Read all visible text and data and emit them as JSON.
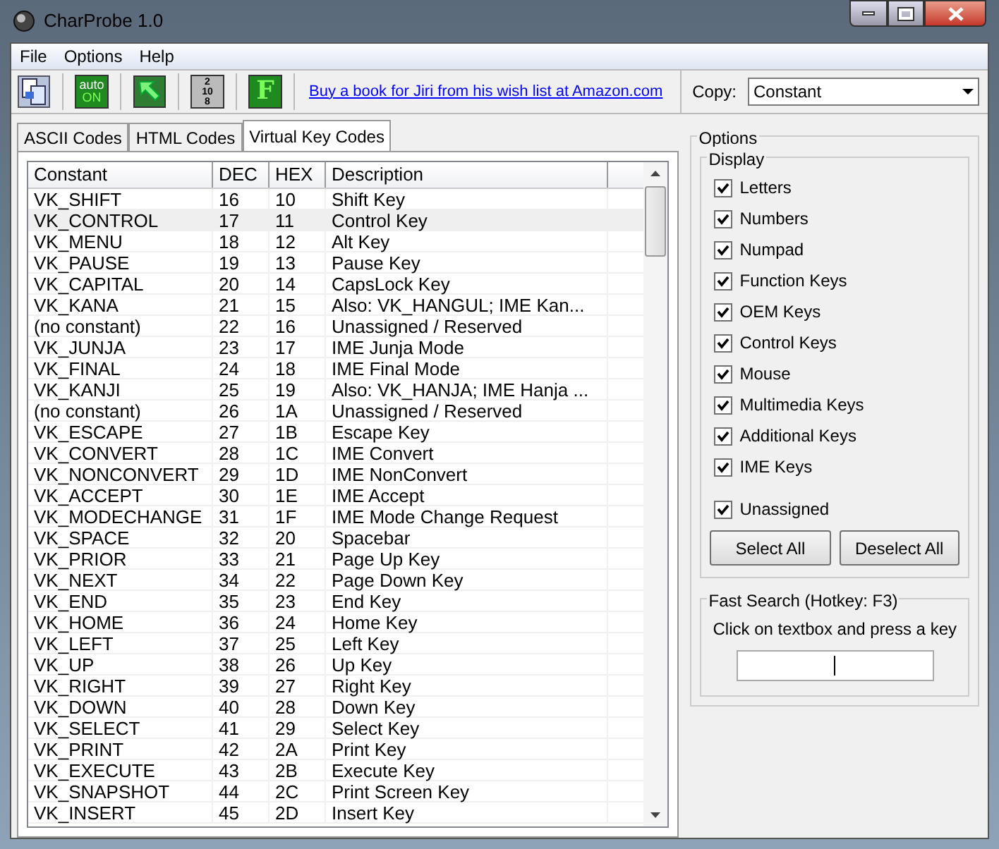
{
  "window": {
    "title": "CharProbe 1.0"
  },
  "menu": [
    "File",
    "Options",
    "Help"
  ],
  "toolbar": {
    "buttons": [
      {
        "kind": "icon"
      },
      {
        "kind": "badge",
        "text": [
          "auto",
          "ON"
        ]
      },
      {
        "kind": "icon"
      },
      {
        "kind": "badge",
        "text": [
          "2",
          "10",
          "8"
        ]
      },
      {
        "kind": "badge",
        "text": [
          "F"
        ]
      }
    ],
    "link": "Buy a book for Jiri from his wish list at Amazon.com",
    "copy_label": "Copy:",
    "copy_value": "Constant"
  },
  "tabs": [
    {
      "label": "ASCII Codes",
      "selected": false
    },
    {
      "label": "HTML Codes",
      "selected": false
    },
    {
      "label": "Virtual Key Codes",
      "selected": true
    }
  ],
  "table": {
    "columns": [
      "Constant",
      "DEC",
      "HEX",
      "Description"
    ],
    "rows": [
      {
        "cells": [
          "VK_SHIFT",
          "16",
          "10",
          "Shift Key"
        ],
        "selected": false
      },
      {
        "cells": [
          "VK_CONTROL",
          "17",
          "11",
          "Control Key"
        ],
        "selected": true
      },
      {
        "cells": [
          "VK_MENU",
          "18",
          "12",
          "Alt Key"
        ],
        "selected": false
      },
      {
        "cells": [
          "VK_PAUSE",
          "19",
          "13",
          "Pause Key"
        ],
        "selected": false
      },
      {
        "cells": [
          "VK_CAPITAL",
          "20",
          "14",
          "CapsLock Key"
        ],
        "selected": false
      },
      {
        "cells": [
          "VK_KANA",
          "21",
          "15",
          "Also: VK_HANGUL; IME Kan..."
        ],
        "selected": false
      },
      {
        "cells": [
          "(no constant)",
          "22",
          "16",
          "Unassigned / Reserved"
        ],
        "selected": false
      },
      {
        "cells": [
          "VK_JUNJA",
          "23",
          "17",
          "IME Junja Mode"
        ],
        "selected": false
      },
      {
        "cells": [
          "VK_FINAL",
          "24",
          "18",
          "IME Final Mode"
        ],
        "selected": false
      },
      {
        "cells": [
          "VK_KANJI",
          "25",
          "19",
          "Also: VK_HANJA; IME Hanja ..."
        ],
        "selected": false
      },
      {
        "cells": [
          "(no constant)",
          "26",
          "1A",
          "Unassigned / Reserved"
        ],
        "selected": false
      },
      {
        "cells": [
          "VK_ESCAPE",
          "27",
          "1B",
          "Escape Key"
        ],
        "selected": false
      },
      {
        "cells": [
          "VK_CONVERT",
          "28",
          "1C",
          "IME Convert"
        ],
        "selected": false
      },
      {
        "cells": [
          "VK_NONCONVERT",
          "29",
          "1D",
          "IME NonConvert"
        ],
        "selected": false
      },
      {
        "cells": [
          "VK_ACCEPT",
          "30",
          "1E",
          "IME Accept"
        ],
        "selected": false
      },
      {
        "cells": [
          "VK_MODECHANGE",
          "31",
          "1F",
          "IME Mode Change Request"
        ],
        "selected": false
      },
      {
        "cells": [
          "VK_SPACE",
          "32",
          "20",
          "Spacebar"
        ],
        "selected": false
      },
      {
        "cells": [
          "VK_PRIOR",
          "33",
          "21",
          "Page Up Key"
        ],
        "selected": false
      },
      {
        "cells": [
          "VK_NEXT",
          "34",
          "22",
          "Page Down Key"
        ],
        "selected": false
      },
      {
        "cells": [
          "VK_END",
          "35",
          "23",
          "End Key"
        ],
        "selected": false
      },
      {
        "cells": [
          "VK_HOME",
          "36",
          "24",
          "Home Key"
        ],
        "selected": false
      },
      {
        "cells": [
          "VK_LEFT",
          "37",
          "25",
          "Left Key"
        ],
        "selected": false
      },
      {
        "cells": [
          "VK_UP",
          "38",
          "26",
          "Up Key"
        ],
        "selected": false
      },
      {
        "cells": [
          "VK_RIGHT",
          "39",
          "27",
          "Right Key"
        ],
        "selected": false
      },
      {
        "cells": [
          "VK_DOWN",
          "40",
          "28",
          "Down Key"
        ],
        "selected": false
      },
      {
        "cells": [
          "VK_SELECT",
          "41",
          "29",
          "Select Key"
        ],
        "selected": false
      },
      {
        "cells": [
          "VK_PRINT",
          "42",
          "2A",
          "Print Key"
        ],
        "selected": false
      },
      {
        "cells": [
          "VK_EXECUTE",
          "43",
          "2B",
          "Execute Key"
        ],
        "selected": false
      },
      {
        "cells": [
          "VK_SNAPSHOT",
          "44",
          "2C",
          "Print Screen Key"
        ],
        "selected": false
      },
      {
        "cells": [
          "VK_INSERT",
          "45",
          "2D",
          "Insert Key"
        ],
        "selected": false
      }
    ]
  },
  "options": {
    "title": "Options",
    "display_title": "Display",
    "checkboxes": [
      {
        "label": "Letters",
        "checked": true
      },
      {
        "label": "Numbers",
        "checked": true
      },
      {
        "label": "Numpad",
        "checked": true
      },
      {
        "label": "Function Keys",
        "checked": true
      },
      {
        "label": "OEM Keys",
        "checked": true
      },
      {
        "label": "Control Keys",
        "checked": true
      },
      {
        "label": "Mouse",
        "checked": true
      },
      {
        "label": "Multimedia Keys",
        "checked": true
      },
      {
        "label": "Additional Keys",
        "checked": true
      },
      {
        "label": "IME Keys",
        "checked": true
      },
      {
        "label": "Unassigned",
        "checked": true
      }
    ],
    "buttons": [
      "Select All",
      "Deselect All"
    ],
    "search_title": "Fast Search (Hotkey: F3)",
    "search_hint": "Click on textbox and press a key"
  }
}
